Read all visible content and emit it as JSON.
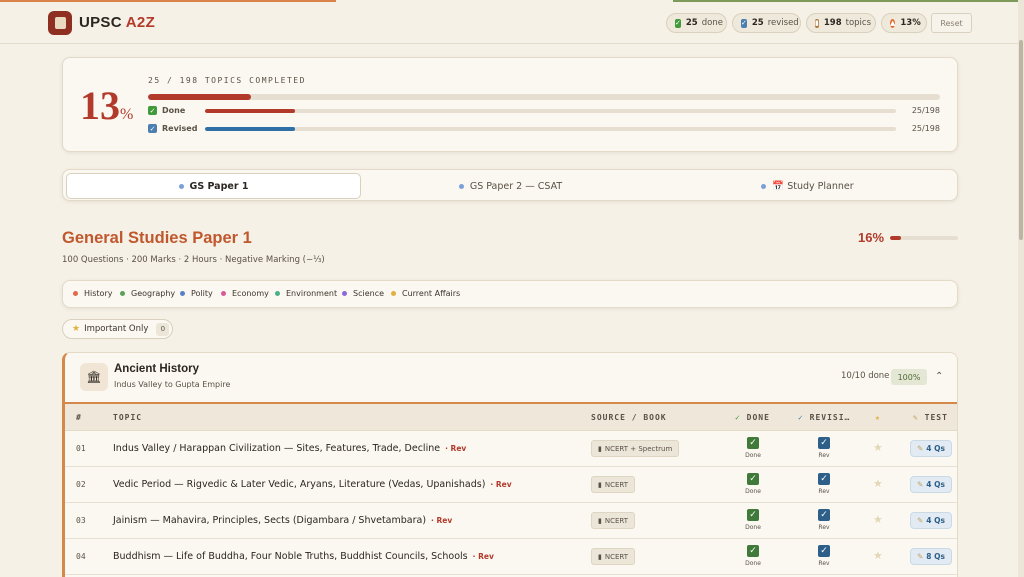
{
  "app": {
    "name": "UPSC",
    "accent_name": "A2Z"
  },
  "colors": {
    "primary": "#b23a2a",
    "done": "#3f7a3a",
    "revised": "#2e5f88",
    "accent": "#c0582e",
    "section": "#d4884a"
  },
  "header": {
    "done_count": "25",
    "done_label": "done",
    "revised_count": "25",
    "revised_label": "revised",
    "topics_count": "198",
    "topics_label": "topics",
    "pct": "13%",
    "reset_label": "Reset",
    "icons": {
      "done": "check-box-icon",
      "revised": "revised-icon",
      "topics": "books-icon",
      "pct": "fire-icon"
    }
  },
  "progress": {
    "big_value": "13",
    "big_unit": "%",
    "fraction": 0.126,
    "heading": "25 / 198 TOPICS COMPLETED",
    "done_label": "Done",
    "done_value": "25/198",
    "revised_label": "Revised",
    "revised_value": "25/198"
  },
  "tabs": [
    {
      "label": "GS Paper 1",
      "active": true
    },
    {
      "label": "GS Paper 2 — CSAT",
      "active": false
    },
    {
      "label": "📅 Study Planner",
      "active": false
    }
  ],
  "paper": {
    "title": "General Studies Paper 1",
    "subtitle": "100 Questions · 200 Marks · 2 Hours · Negative Marking (−⅓)",
    "pct": "16%",
    "fraction": 0.16
  },
  "filters": [
    {
      "label": "History",
      "color": "#e06a4a"
    },
    {
      "label": "Geography",
      "color": "#5aa05a"
    },
    {
      "label": "Polity",
      "color": "#5a7fc8"
    },
    {
      "label": "Economy",
      "color": "#d85a9a"
    },
    {
      "label": "Environment",
      "color": "#4ab08a"
    },
    {
      "label": "Science",
      "color": "#8a6ad8"
    },
    {
      "label": "Current Affairs",
      "color": "#e0b040"
    }
  ],
  "important": {
    "label": "Important Only",
    "count": "0"
  },
  "section": {
    "icon": "temple-icon",
    "title": "Ancient History",
    "subtitle": "Indus Valley to Gupta Empire",
    "done": "10/10 done",
    "pct": "100%"
  },
  "table": {
    "headers": {
      "num": "#",
      "topic": "TOPIC",
      "source": "SOURCE / BOOK",
      "done": "DONE",
      "revision": "REVISI…",
      "test": "TEST"
    },
    "done_label": "Done",
    "rev_label": "Rev",
    "rev_tag": "· Rev",
    "rows": [
      {
        "num": "01",
        "topic": "Indus Valley / Harappan Civilization — Sites, Features, Trade, Decline",
        "source": "NCERT + Spectrum",
        "qs": "4 Qs"
      },
      {
        "num": "02",
        "topic": "Vedic Period — Rigvedic & Later Vedic, Aryans, Literature (Vedas, Upanishads)",
        "source": "NCERT",
        "qs": "4 Qs"
      },
      {
        "num": "03",
        "topic": "Jainism — Mahavira, Principles, Sects (Digambara / Shvetambara)",
        "source": "NCERT",
        "qs": "4 Qs"
      },
      {
        "num": "04",
        "topic": "Buddhism — Life of Buddha, Four Noble Truths, Buddhist Councils, Schools",
        "source": "NCERT",
        "qs": "8 Qs"
      }
    ]
  }
}
